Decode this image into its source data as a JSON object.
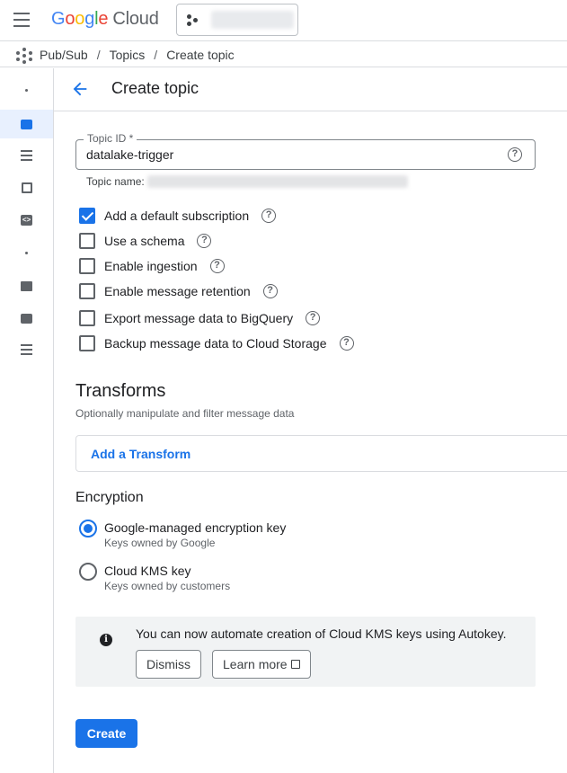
{
  "header": {
    "logo_google": [
      "G",
      "o",
      "o",
      "g",
      "l",
      "e"
    ],
    "logo_cloud": "Cloud"
  },
  "breadcrumb": {
    "items": [
      "Pub/Sub",
      "Topics",
      "Create topic"
    ],
    "separator": "/"
  },
  "page": {
    "title": "Create topic"
  },
  "topic_id": {
    "label": "Topic ID *",
    "value": "datalake-trigger",
    "topic_name_label": "Topic name:"
  },
  "options": [
    {
      "label": "Add a default subscription",
      "checked": true
    },
    {
      "label": "Use a schema",
      "checked": false
    },
    {
      "label": "Enable ingestion",
      "checked": false
    },
    {
      "label": "Enable message retention",
      "checked": false
    },
    {
      "label": "Export message data to BigQuery",
      "checked": false
    },
    {
      "label": "Backup message data to Cloud Storage",
      "checked": false
    }
  ],
  "transforms": {
    "title": "Transforms",
    "subtitle": "Optionally manipulate and filter message data",
    "add_label": "Add a Transform"
  },
  "encryption": {
    "title": "Encryption",
    "choices": [
      {
        "label": "Google-managed encryption key",
        "sub": "Keys owned by Google",
        "selected": true
      },
      {
        "label": "Cloud KMS key",
        "sub": "Keys owned by customers",
        "selected": false
      }
    ]
  },
  "banner": {
    "text": "You can now automate creation of Cloud KMS keys using Autokey.",
    "dismiss_label": "Dismiss",
    "learn_more_label": "Learn more"
  },
  "actions": {
    "create_label": "Create"
  },
  "colors": {
    "accent": "#1a73e8",
    "active_rail_bg": "#e8f0fe"
  }
}
